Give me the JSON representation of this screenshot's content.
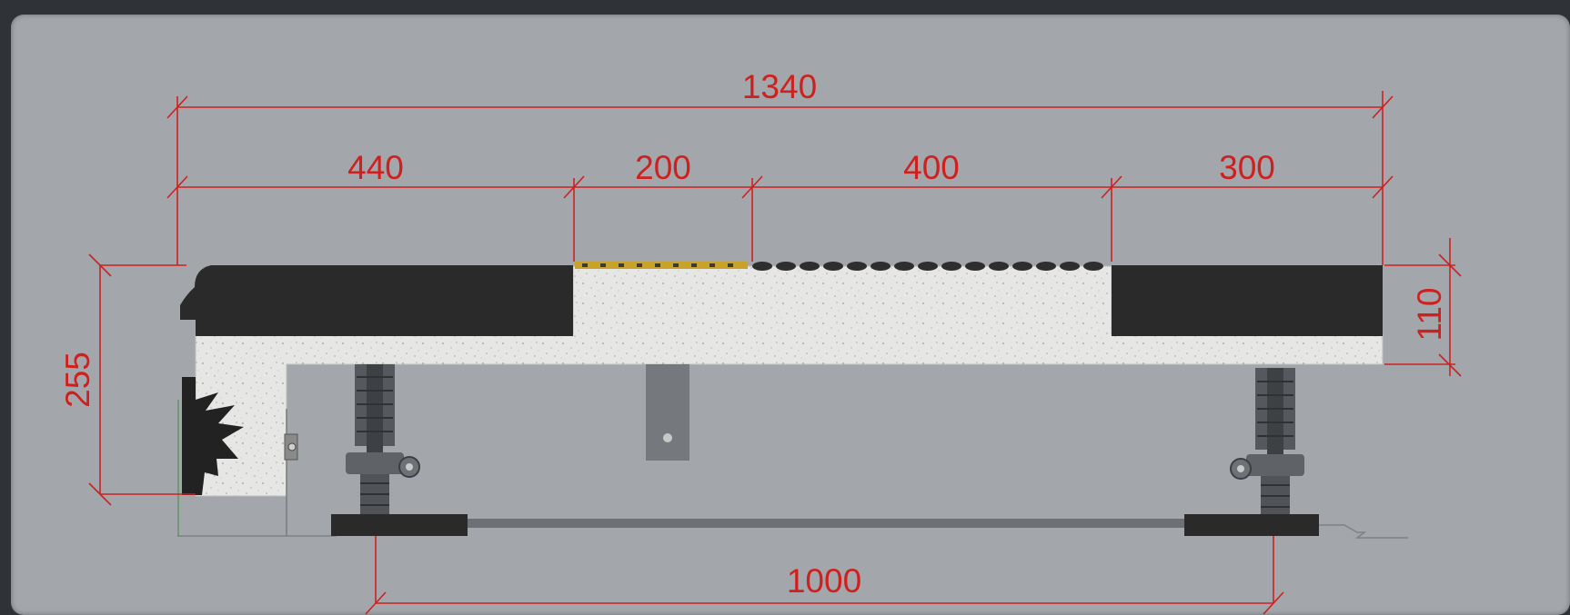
{
  "colors": {
    "background": "#2f3338",
    "panel": "#a3a7ab",
    "dimension": "#cf2020",
    "concrete": "#e4e4e2",
    "rubber": "#2a2a2a",
    "steel": "#4d5054"
  },
  "dimensions": {
    "overall_width": "1340",
    "segment_1": "440",
    "segment_2": "200",
    "segment_3": "400",
    "segment_4": "300",
    "total_height": "255",
    "deck_thickness": "110",
    "support_spacing": "1000"
  }
}
